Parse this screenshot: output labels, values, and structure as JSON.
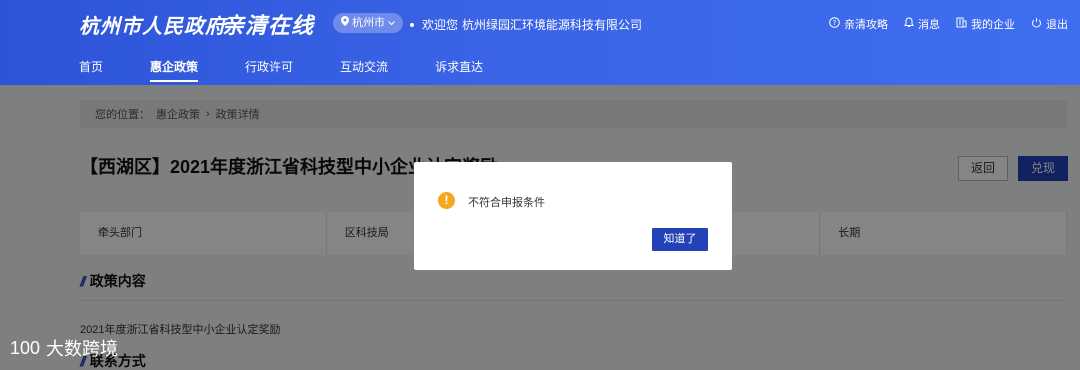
{
  "header": {
    "brand": "杭州市人民政府",
    "slogan": "亲清在线",
    "city": "杭州市",
    "welcome_prefix": "欢迎您",
    "company": "杭州绿园汇环境能源科技有限公司",
    "links": [
      {
        "label": "亲清攻略",
        "icon": "help-circle-icon"
      },
      {
        "label": "消息",
        "icon": "bell-icon"
      },
      {
        "label": "我的企业",
        "icon": "building-icon"
      },
      {
        "label": "退出",
        "icon": "power-icon"
      }
    ]
  },
  "nav": {
    "items": [
      "首页",
      "惠企政策",
      "行政许可",
      "互动交流",
      "诉求直达"
    ],
    "active": "惠企政策"
  },
  "breadcrumb": {
    "prefix": "您的位置：",
    "items": [
      "惠企政策",
      "政策详情"
    ]
  },
  "policy": {
    "title": "【西湖区】2021年度浙江省科技型中小企业认定奖励",
    "back_label": "返回",
    "redeem_label": "兑现",
    "info": [
      "牵头部门",
      "区科技局",
      "",
      "长期"
    ],
    "section_content": "政策内容",
    "content_text": "2021年度浙江省科技型中小企业认定奖励",
    "section_contact": "联系方式"
  },
  "dialog": {
    "message": "不符合申报条件",
    "confirm_label": "知道了",
    "icon": "warning-icon",
    "icon_color": "#f5a623"
  },
  "watermark": {
    "text": "大数跨境",
    "logo": "100"
  },
  "colors": {
    "header_blue": "#3a63e6",
    "primary_button": "#2442b8"
  }
}
